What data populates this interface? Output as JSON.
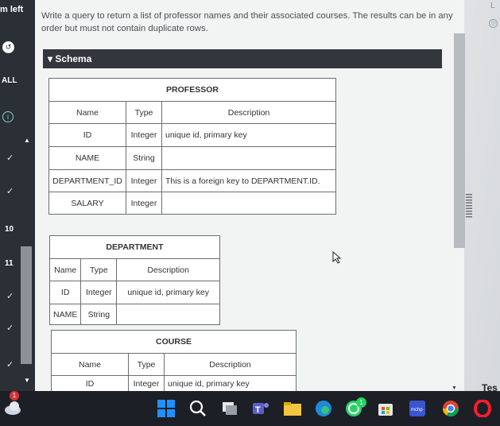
{
  "left_rail": {
    "top_text": "m left",
    "all_label": "ALL",
    "numbers": [
      "10",
      "11"
    ]
  },
  "right_panel": {
    "top_text": "L",
    "bottom_text": "Tes"
  },
  "question": "Write a query to return a list of professor names and their associated courses. The results can be in any order but must not contain duplicate rows.",
  "schema": {
    "label": "▾ Schema"
  },
  "tables": {
    "professor": {
      "title": "PROFESSOR",
      "headers": [
        "Name",
        "Type",
        "Description"
      ],
      "rows": [
        [
          "ID",
          "Integer",
          "unique id, primary key"
        ],
        [
          "NAME",
          "String",
          ""
        ],
        [
          "DEPARTMENT_ID",
          "Integer",
          "This is a foreign key to DEPARTMENT.ID."
        ],
        [
          "SALARY",
          "Integer",
          ""
        ]
      ]
    },
    "department": {
      "title": "DEPARTMENT",
      "headers": [
        "Name",
        "Type",
        "Description"
      ],
      "rows": [
        [
          "ID",
          "Integer",
          "unique id, primary key"
        ],
        [
          "NAME",
          "String",
          ""
        ]
      ]
    },
    "course": {
      "title": "COURSE",
      "headers": [
        "Name",
        "Type",
        "Description"
      ],
      "rows": [
        [
          "ID",
          "Integer",
          "unique id, primary key"
        ]
      ]
    }
  },
  "taskbar": {
    "weather_badge": "1",
    "whatsapp_badge": "1",
    "icons": [
      "weather-icon",
      "windows-start-icon",
      "search-icon",
      "task-view-icon",
      "teams-icon",
      "file-explorer-icon",
      "edge-icon",
      "whatsapp-icon",
      "store-icon",
      "mchp-icon",
      "chrome-icon",
      "opera-icon"
    ]
  },
  "colors": {
    "rail": "#2b2f36",
    "schema_bar": "#33373d",
    "taskbar": "#1c1f26"
  }
}
